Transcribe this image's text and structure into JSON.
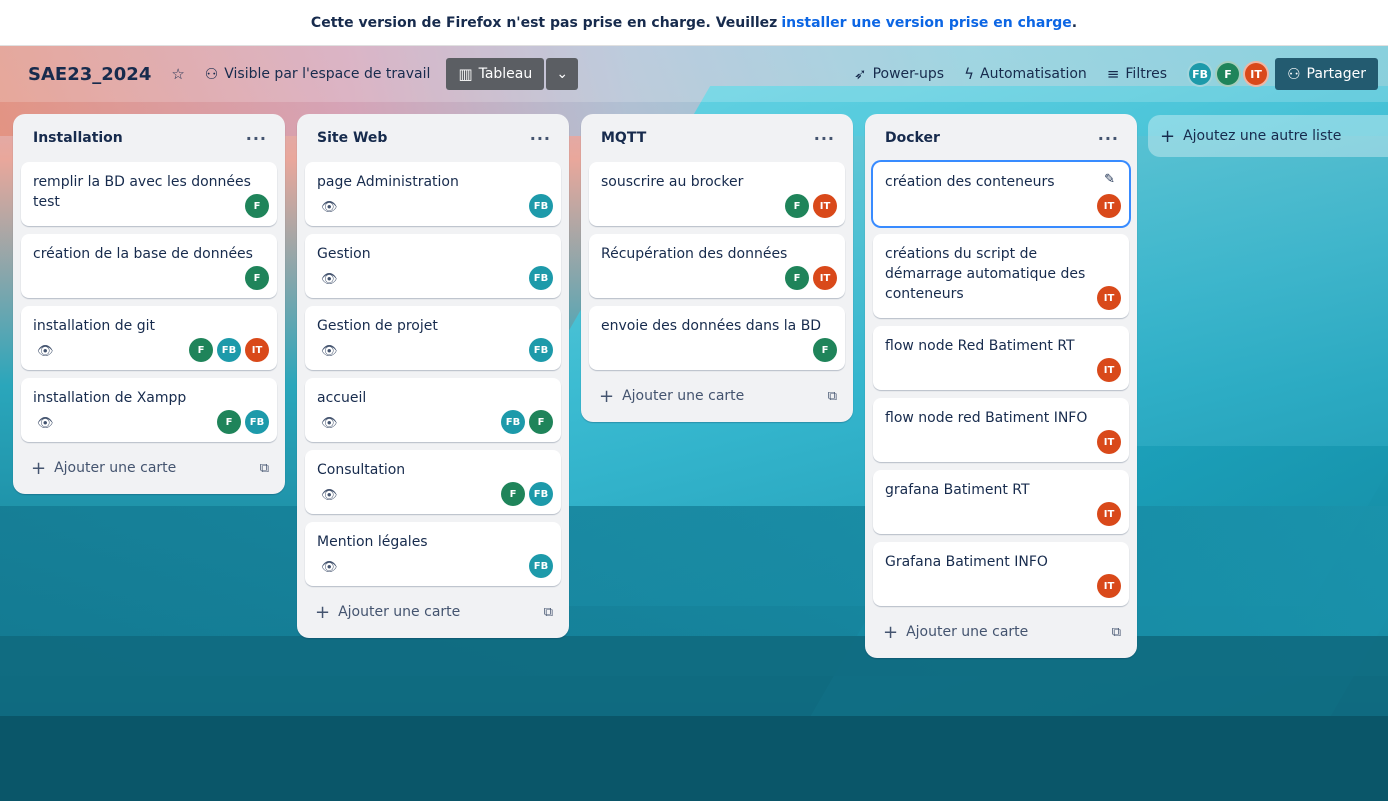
{
  "banner": {
    "text": "Cette version de Firefox n'est pas prise en charge. Veuillez",
    "link": "installer une version prise en charge",
    "end": "."
  },
  "header": {
    "board_title": "SAE23_2024",
    "visibility": "Visible par l'espace de travail",
    "view": "Tableau",
    "powerups": "Power-ups",
    "automation": "Automatisation",
    "filters": "Filtres",
    "share": "Partager",
    "members": [
      "FB",
      "F",
      "IT"
    ]
  },
  "colors": {
    "F": "#1f845a",
    "FB": "#1d9aaa",
    "IT": "#d9491a"
  },
  "lists": [
    {
      "title": "Installation",
      "add_label": "Ajouter une carte",
      "cards": [
        {
          "title": "remplir la BD avec les données test",
          "members": [
            "F"
          ]
        },
        {
          "title": "création de la base de données",
          "members": [
            "F"
          ]
        },
        {
          "title": "installation de git",
          "members": [
            "F",
            "FB",
            "IT"
          ],
          "watch": true
        },
        {
          "title": "installation de Xampp",
          "members": [
            "F",
            "FB"
          ],
          "watch": true
        }
      ]
    },
    {
      "title": "Site Web",
      "add_label": "Ajouter une carte",
      "cards": [
        {
          "title": "page Administration",
          "members": [
            "FB"
          ],
          "watch": true
        },
        {
          "title": "Gestion",
          "members": [
            "FB"
          ],
          "watch": true
        },
        {
          "title": "Gestion de projet",
          "members": [
            "FB"
          ],
          "watch": true
        },
        {
          "title": "accueil",
          "members": [
            "FB",
            "F"
          ],
          "watch": true
        },
        {
          "title": "Consultation",
          "members": [
            "F",
            "FB"
          ],
          "watch": true
        },
        {
          "title": "Mention légales",
          "members": [
            "FB"
          ],
          "watch": true
        }
      ]
    },
    {
      "title": "MQTT",
      "add_label": "Ajouter une carte",
      "cards": [
        {
          "title": "souscrire au brocker",
          "members": [
            "F",
            "IT"
          ]
        },
        {
          "title": "Récupération des données",
          "members": [
            "F",
            "IT"
          ]
        },
        {
          "title": "envoie des données dans la BD",
          "members": [
            "F"
          ]
        }
      ]
    },
    {
      "title": "Docker",
      "add_label": "Ajouter une carte",
      "cards": [
        {
          "title": "création des conteneurs",
          "members": [
            "IT"
          ],
          "active": true
        },
        {
          "title": "créations du script de démarrage automatique des conteneurs",
          "members": [
            "IT"
          ],
          "tall": true
        },
        {
          "title": "flow node Red Batiment RT",
          "members": [
            "IT"
          ]
        },
        {
          "title": "flow node red Batiment INFO",
          "members": [
            "IT"
          ]
        },
        {
          "title": "grafana Batiment RT",
          "members": [
            "IT"
          ]
        },
        {
          "title": "Grafana Batiment INFO",
          "members": [
            "IT"
          ]
        }
      ]
    }
  ],
  "add_list_label": "Ajoutez une autre liste"
}
